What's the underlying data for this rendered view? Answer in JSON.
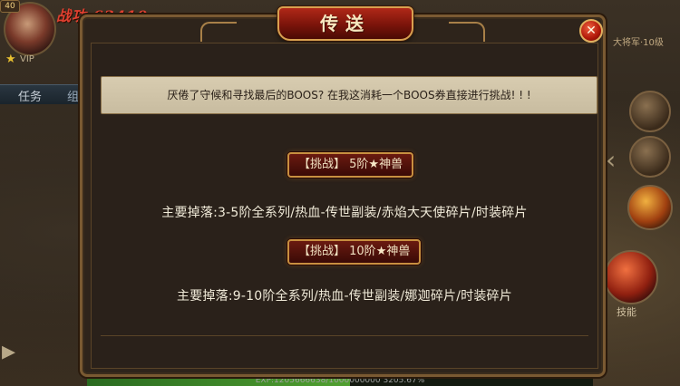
{
  "hud": {
    "level": "40",
    "power_label": "战功 63410",
    "vip_text": "VIP",
    "tab_renwu": "任务",
    "tab_zudui": "组队",
    "right_info": "大将军·10级",
    "skill_label": "技能",
    "exp_text": "EXP:1205666638/1000000000 3205.67%",
    "exp_fill": 0.52
  },
  "dialog": {
    "title": "传送",
    "close_glyph": "✕",
    "notice": "厌倦了守候和寻找最后的BOOS? 在我这消耗一个BOOS券直接进行挑战! ! !",
    "entries": [
      {
        "button_prefix": "【挑战】 5阶",
        "button_star": "★",
        "button_suffix": "神兽",
        "drops": "主要掉落:3-5阶全系列/热血-传世副装/赤焰大天使碎片/时装碎片"
      },
      {
        "button_prefix": "【挑战】 10阶",
        "button_star": "★",
        "button_suffix": "神兽",
        "drops": "主要掉落:9-10阶全系列/热血-传世副装/娜迦碎片/时装碎片"
      }
    ]
  },
  "colors": {
    "accent_gold": "#c89040",
    "title_red": "#b02818",
    "notice_bg": "#d8ccb0"
  }
}
